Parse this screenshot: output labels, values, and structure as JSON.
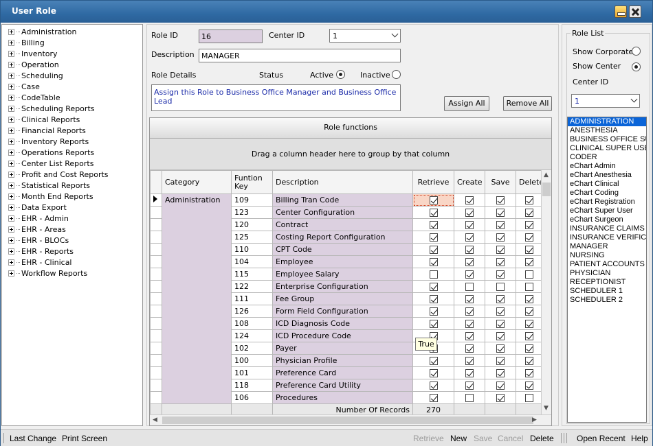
{
  "window": {
    "title": "User Role"
  },
  "tree": [
    "Administration",
    "Billing",
    "Inventory",
    "Operation",
    "Scheduling",
    "Case",
    "CodeTable",
    "Scheduling Reports",
    "Clinical Reports",
    "Financial Reports",
    "Inventory Reports",
    "Operations Reports",
    "Center List Reports",
    "Profit and Cost Reports",
    "Statistical Reports",
    "Month End Reports",
    "Data Export",
    "EHR - Admin",
    "EHR - Areas",
    "EHR - BLOCs",
    "EHR - Reports",
    "EHR - Clinical",
    "Workflow Reports"
  ],
  "form": {
    "role_id_label": "Role ID",
    "role_id": "16",
    "center_id_label": "Center ID",
    "center_id": "1",
    "description_label": "Description",
    "description": "MANAGER",
    "role_details_label": "Role Details",
    "status_label": "Status",
    "active_label": "Active",
    "inactive_label": "Inactive",
    "details_text": "Assign this Role to Business Office Manager and Business Office Lead",
    "assign_all": "Assign All",
    "remove_all": "Remove All"
  },
  "grid": {
    "header": "Role functions",
    "group_hint": "Drag a column header here to group by that column",
    "columns": {
      "category": "Category",
      "key": "Funtion Key",
      "description": "Description",
      "retrieve": "Retrieve",
      "create": "Create",
      "save": "Save",
      "delete": "Delete"
    },
    "category": "Administration",
    "rows": [
      {
        "key": "109",
        "desc": "Billing Tran Code",
        "r": true,
        "c": true,
        "s": true,
        "d": true
      },
      {
        "key": "123",
        "desc": "Center Configuration",
        "r": true,
        "c": true,
        "s": true,
        "d": true
      },
      {
        "key": "120",
        "desc": "Contract",
        "r": true,
        "c": true,
        "s": true,
        "d": true
      },
      {
        "key": "125",
        "desc": "Costing Report Configuration",
        "r": true,
        "c": true,
        "s": true,
        "d": true
      },
      {
        "key": "110",
        "desc": "CPT Code",
        "r": true,
        "c": true,
        "s": true,
        "d": true
      },
      {
        "key": "104",
        "desc": "Employee",
        "r": true,
        "c": true,
        "s": true,
        "d": true
      },
      {
        "key": "115",
        "desc": "Employee Salary",
        "r": false,
        "c": true,
        "s": true,
        "d": false
      },
      {
        "key": "122",
        "desc": "Enterprise Configuration",
        "r": true,
        "c": false,
        "s": false,
        "d": false
      },
      {
        "key": "111",
        "desc": "Fee Group",
        "r": true,
        "c": true,
        "s": true,
        "d": true
      },
      {
        "key": "126",
        "desc": "Form Field Configuration",
        "r": true,
        "c": true,
        "s": true,
        "d": true
      },
      {
        "key": "108",
        "desc": "ICD Diagnosis Code",
        "r": true,
        "c": true,
        "s": true,
        "d": true
      },
      {
        "key": "124",
        "desc": "ICD Procedure Code",
        "r": true,
        "c": true,
        "s": true,
        "d": true
      },
      {
        "key": "102",
        "desc": "Payer",
        "r": true,
        "c": true,
        "s": true,
        "d": true
      },
      {
        "key": "100",
        "desc": "Physician Profile",
        "r": true,
        "c": true,
        "s": true,
        "d": true
      },
      {
        "key": "101",
        "desc": "Preference Card",
        "r": true,
        "c": true,
        "s": true,
        "d": true
      },
      {
        "key": "118",
        "desc": "Preference Card Utility",
        "r": true,
        "c": true,
        "s": true,
        "d": true
      },
      {
        "key": "106",
        "desc": "Procedures",
        "r": true,
        "c": false,
        "s": true,
        "d": false
      }
    ],
    "records_label": "Number Of Records",
    "records": "270",
    "tooltip": "True"
  },
  "rolelist": {
    "legend": "Role List",
    "show_corporate": "Show Corporate",
    "show_center": "Show Center",
    "center_id_label": "Center ID",
    "center_id": "1",
    "items": [
      "ADMINISTRATION",
      "ANESTHESIA",
      "BUSINESS OFFICE SU",
      "CLINICAL SUPER USE",
      "CODER",
      "eChart Admin",
      "eChart Anesthesia",
      "eChart Clinical",
      "eChart Coding",
      "eChart Registration",
      "eChart Super User",
      "eChart Surgeon",
      "INSURANCE CLAIMS",
      "INSURANCE VERIFICA",
      "MANAGER",
      "NURSING",
      "PATIENT ACCOUNTS",
      "PHYSICIAN",
      "RECEPTIONIST",
      "SCHEDULER 1",
      "SCHEDULER 2"
    ]
  },
  "statusbar": {
    "last_change": "Last Change",
    "print_screen": "Print Screen",
    "retrieve": "Retrieve",
    "new": "New",
    "save": "Save",
    "cancel": "Cancel",
    "delete": "Delete",
    "open_recent": "Open Recent",
    "help": "Help"
  }
}
